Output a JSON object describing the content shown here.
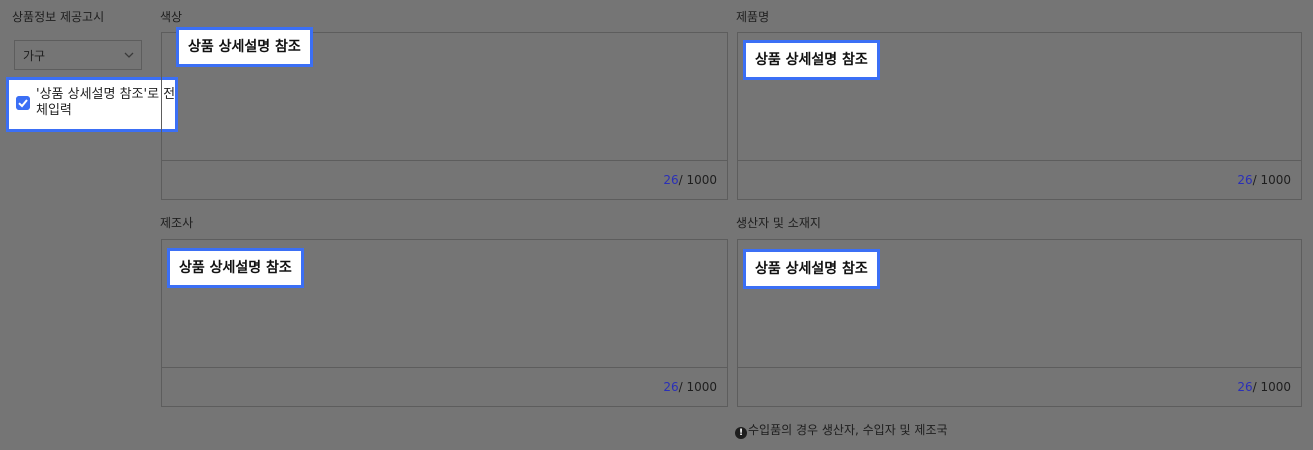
{
  "sidebar": {
    "title": "상품정보 제공고시",
    "category_select": {
      "value": "가구"
    },
    "bulk_checkbox": {
      "checked": true,
      "label": "'상품 상세설명 참조'로 전체입력"
    }
  },
  "fields": [
    {
      "label": "색상",
      "value": "상품 상세설명 참조",
      "count": "26",
      "max": "/ 1000"
    },
    {
      "label": "제품명",
      "value": "상품 상세설명 참조",
      "count": "26",
      "max": "/ 1000"
    },
    {
      "label": "제조사",
      "value": "상품 상세설명 참조",
      "count": "26",
      "max": "/ 1000"
    },
    {
      "label": "생산자 및 소재지",
      "value": "상품 상세설명 참조",
      "count": "26",
      "max": "/ 1000"
    }
  ],
  "notice": {
    "icon": "info-icon",
    "text": "수입품의 경우 생산자, 수입자 및 제조국"
  },
  "colors": {
    "accent": "#3b6ff5",
    "counter_number": "#2a2fb8",
    "overlay_bg": "#757575"
  }
}
